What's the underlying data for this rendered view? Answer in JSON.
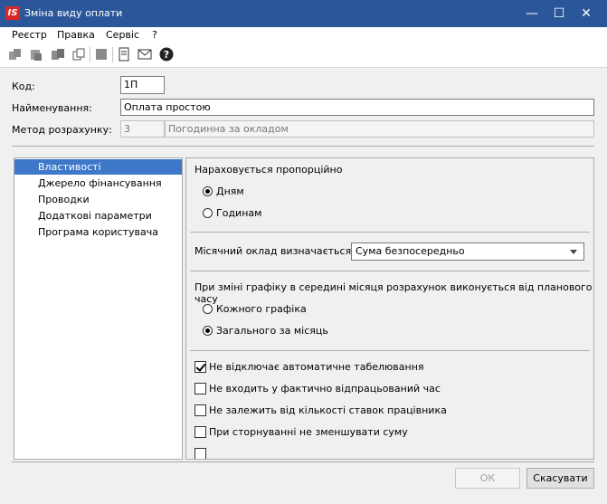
{
  "window": {
    "logo": "IS",
    "title": "Зміна виду оплати",
    "controls": {
      "minimize": "—",
      "maximize": "☐",
      "close": "✕"
    }
  },
  "menu": [
    "Реєстр",
    "Правка",
    "Сервіс",
    "?"
  ],
  "toolbar_icons": [
    "copy-icon",
    "paste-icon",
    "move-icon",
    "duplicate-icon",
    "delete-icon",
    "document-icon",
    "mail-icon",
    "help-icon"
  ],
  "form": {
    "code_label": "Код:",
    "code_value": "1П",
    "name_label": "Найменування:",
    "name_value": "Оплата простою",
    "method_label": "Метод розрахунку:",
    "method_code": "3",
    "method_name": "Погодинна за окладом"
  },
  "nav": {
    "items": [
      "Властивості",
      "Джерело фінансування",
      "Проводки",
      "Додаткові параметри",
      "Програма користувача"
    ],
    "selected_index": 0
  },
  "properties": {
    "proportional_title": "Нараховується пропорційно",
    "proportional_options": [
      {
        "label": "Дням",
        "checked": true
      },
      {
        "label": "Годинам",
        "checked": false
      }
    ],
    "salary_label": "Місячний оклад визначається:",
    "salary_value": "Сума безпосередньо",
    "schedule_title": "При зміні графіку в середині місяця розрахунок виконується від планового часу",
    "schedule_options": [
      {
        "label": "Кожного графіка",
        "checked": false
      },
      {
        "label": "Загального за місяць",
        "checked": true
      }
    ],
    "checkboxes": [
      {
        "label": "Не відключає автоматичне табелювання",
        "checked": true
      },
      {
        "label": "Не входить у фактично відпрацьований час",
        "checked": false
      },
      {
        "label": "Не залежить від кількості ставок працівника",
        "checked": false
      },
      {
        "label": "При сторнуванні не зменшувати суму",
        "checked": false
      },
      {
        "label": "",
        "checked": false
      }
    ]
  },
  "buttons": {
    "ok": "ОК",
    "cancel": "Скасувати"
  }
}
